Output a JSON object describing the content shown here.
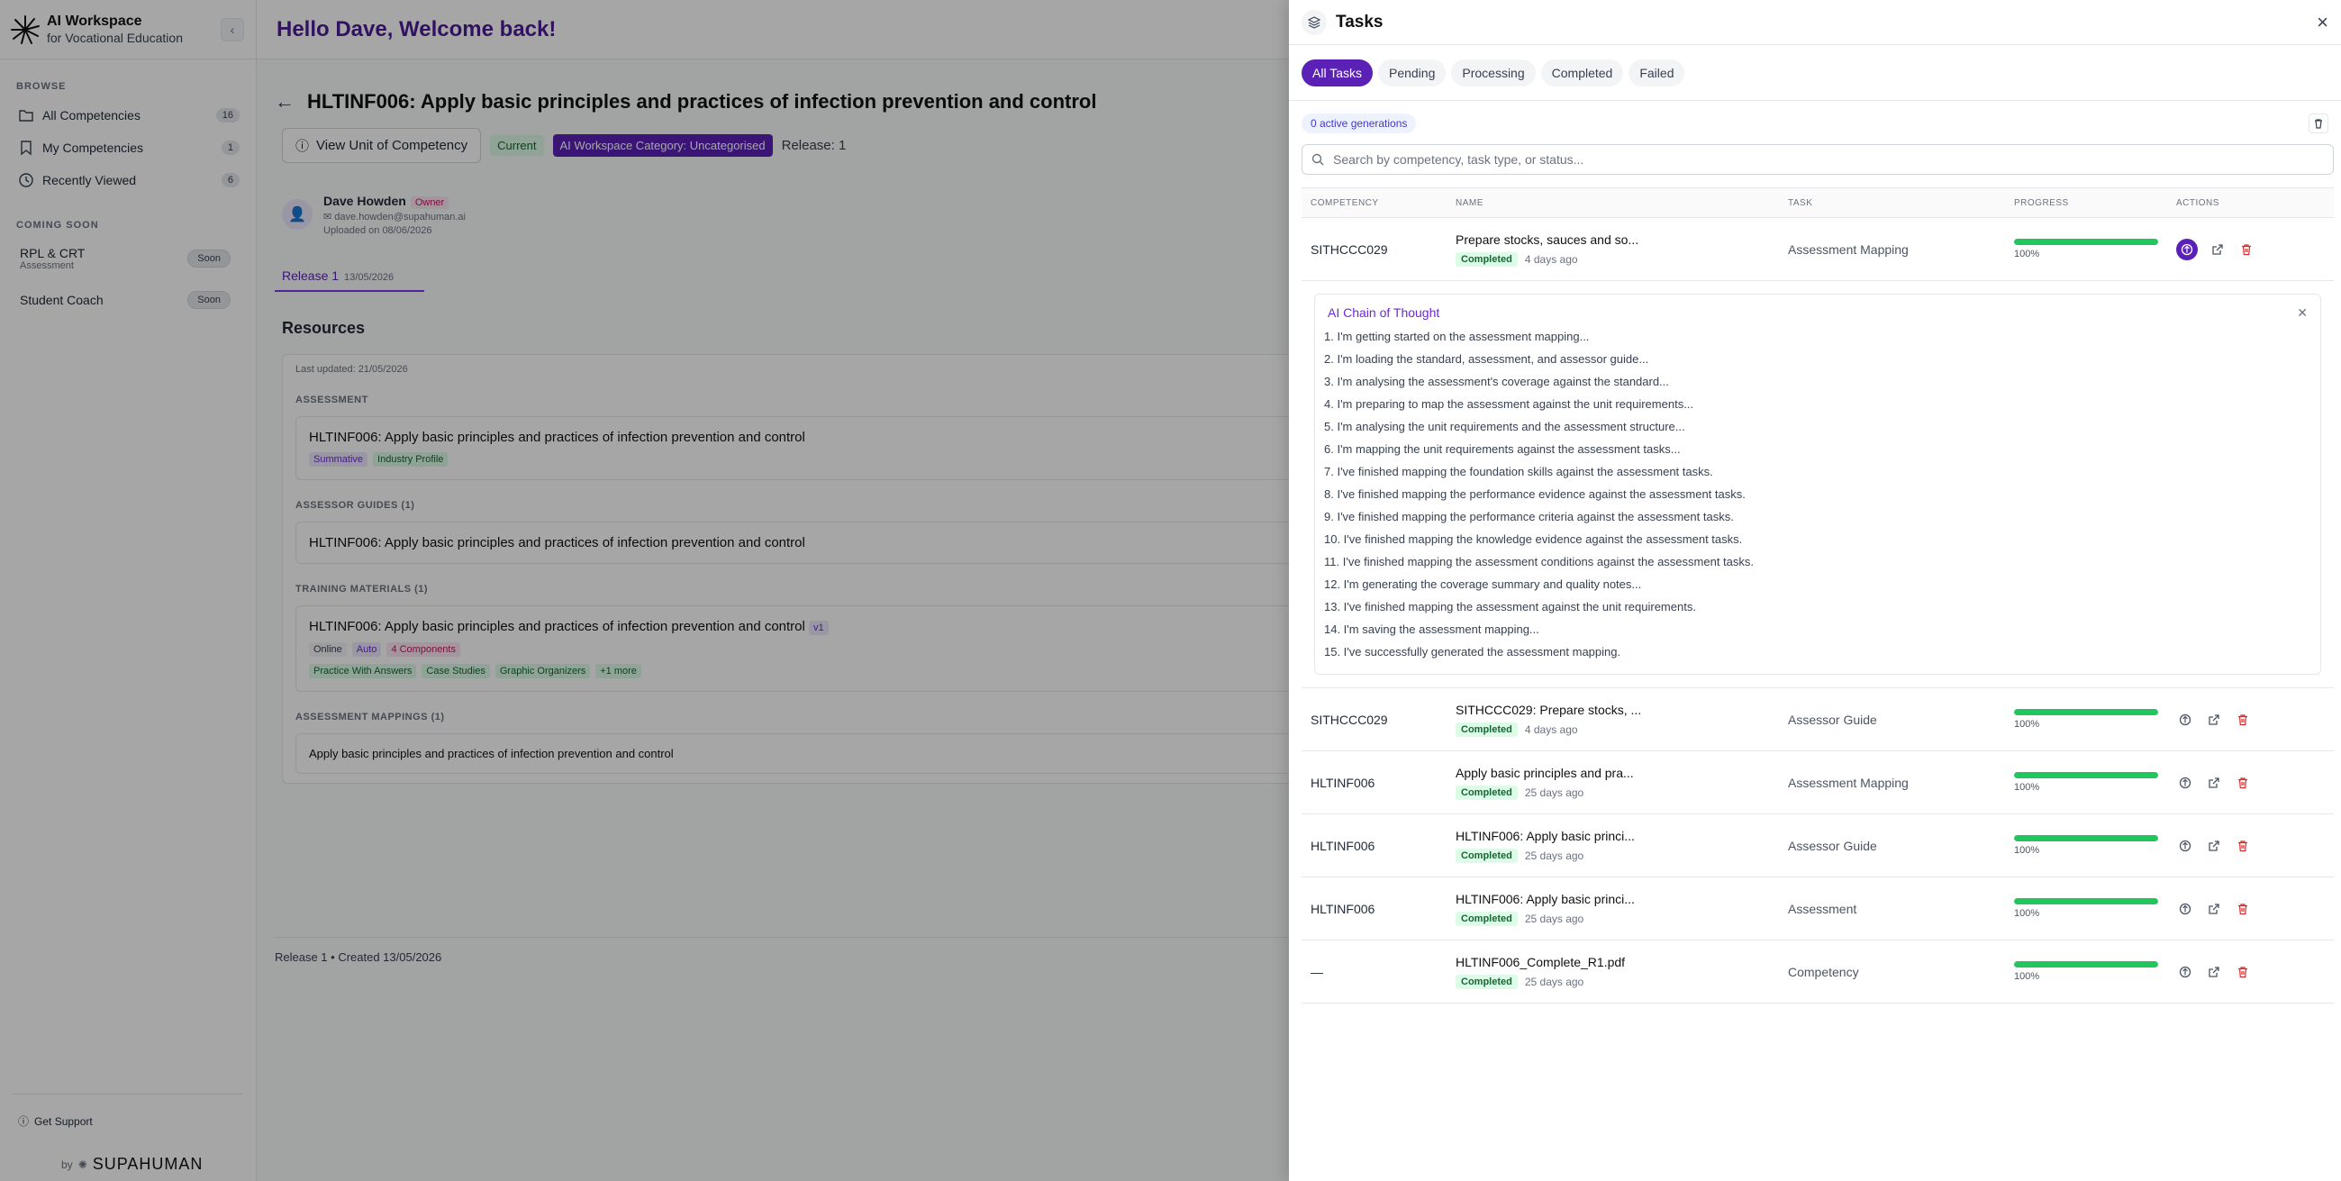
{
  "sidebar": {
    "brand_title": "AI Workspace",
    "brand_sub": "for Vocational Education",
    "browse_label": "BROWSE",
    "items": [
      {
        "label": "All Competencies",
        "count": "16",
        "icon": "folder-icon"
      },
      {
        "label": "My Competencies",
        "count": "1",
        "icon": "bookmark-icon"
      },
      {
        "label": "Recently Viewed",
        "count": "6",
        "icon": "clock-icon"
      }
    ],
    "coming_soon_label": "COMING SOON",
    "soon_items": [
      {
        "label": "RPL & CRT",
        "sub": "Assessment",
        "badge": "Soon"
      },
      {
        "label": "Student Coach",
        "sub": "",
        "badge": "Soon"
      }
    ],
    "support": "Get Support",
    "powered_by": "by",
    "powered_brand": "SUPAHUMAN"
  },
  "main": {
    "greeting": "Hello Dave, Welcome back!",
    "title": "HLTINF006: Apply basic principles and practices of infection prevention and control",
    "view_unit": "View Unit of Competency",
    "current": "Current",
    "category": "AI Workspace Category: Uncategorised",
    "release": "Release: 1",
    "owner_name": "Dave Howden",
    "owner_badge": "Owner",
    "owner_email": "dave.howden@supahuman.ai",
    "uploaded": "Uploaded on 08/06/2026",
    "release_tab": "Release 1",
    "release_tab_date": "13/05/2026",
    "resources_title": "Resources",
    "last_updated": "Last updated: 21/05/2026",
    "sections": {
      "assessment": "ASSESSMENT",
      "assessor_guides": "ASSESSOR GUIDES (1)",
      "training": "TRAINING MATERIALS (1)",
      "mappings": "ASSESSMENT MAPPINGS (1)"
    },
    "assessment_item": "HLTINF006: Apply basic principles and practices of infection prevention and control",
    "assessment_tags": [
      "Summative",
      "Industry Profile"
    ],
    "guide_item": "HLTINF006: Apply basic principles and practices of infection prevention and control",
    "training_item": "HLTINF006: Apply basic principles and practices of infection prevention and control",
    "training_version": "v1",
    "training_tags_a": [
      "Online",
      "Auto",
      "4 Components"
    ],
    "training_tags_b": [
      "Practice With Answers",
      "Case Studies",
      "Graphic Organizers",
      "+1 more"
    ],
    "mapping_item": "Apply basic principles and practices of infection prevention and control",
    "footer": "Release 1 • Created 13/05/2026"
  },
  "tasks": {
    "title": "Tasks",
    "tabs": [
      "All Tasks",
      "Pending",
      "Processing",
      "Completed",
      "Failed"
    ],
    "active_tab": "All Tasks",
    "active_generations": "0 active generations",
    "search_placeholder": "Search by competency, task type, or status...",
    "headers": [
      "COMPETENCY",
      "NAME",
      "TASK",
      "PROGRESS",
      "ACTIONS"
    ],
    "rows": [
      {
        "competency": "SITHCCC029",
        "name": "Prepare stocks, sauces and so...",
        "status": "Completed",
        "time": "4 days ago",
        "task": "Assessment Mapping",
        "progress": 1.0,
        "progress_label": "100%"
      },
      {
        "competency": "SITHCCC029",
        "name": "SITHCCC029: Prepare stocks, ...",
        "status": "Completed",
        "time": "4 days ago",
        "task": "Assessor Guide",
        "progress": 1.0,
        "progress_label": "100%"
      },
      {
        "competency": "HLTINF006",
        "name": "Apply basic principles and pra...",
        "status": "Completed",
        "time": "25 days ago",
        "task": "Assessment Mapping",
        "progress": 1.0,
        "progress_label": "100%"
      },
      {
        "competency": "HLTINF006",
        "name": "HLTINF006: Apply basic princi...",
        "status": "Completed",
        "time": "25 days ago",
        "task": "Assessor Guide",
        "progress": 1.0,
        "progress_label": "100%"
      },
      {
        "competency": "HLTINF006",
        "name": "HLTINF006: Apply basic princi...",
        "status": "Completed",
        "time": "25 days ago",
        "task": "Assessment",
        "progress": 1.0,
        "progress_label": "100%"
      },
      {
        "competency": "—",
        "name": "HLTINF006_Complete_R1.pdf",
        "status": "Completed",
        "time": "25 days ago",
        "task": "Competency",
        "progress": 1.0,
        "progress_label": "100%"
      }
    ],
    "cot_title": "AI Chain of Thought",
    "cot_steps": [
      "1. I'm getting started on the assessment mapping...",
      "2. I'm loading the standard, assessment, and assessor guide...",
      "3. I'm analysing the assessment's coverage against the standard...",
      "4. I'm preparing to map the assessment against the unit requirements...",
      "5. I'm analysing the unit requirements and the assessment structure...",
      "6. I'm mapping the unit requirements against the assessment tasks...",
      "7. I've finished mapping the foundation skills against the assessment tasks.",
      "8. I've finished mapping the performance evidence against the assessment tasks.",
      "9. I've finished mapping the performance criteria against the assessment tasks.",
      "10. I've finished mapping the knowledge evidence against the assessment tasks.",
      "11. I've finished mapping the assessment conditions against the assessment tasks.",
      "12. I'm generating the coverage summary and quality notes...",
      "13. I've finished mapping the assessment against the unit requirements.",
      "14. I'm saving the assessment mapping...",
      "15. I've successfully generated the assessment mapping."
    ]
  },
  "colors": {
    "accent": "#5b21b6",
    "progress": "#22c55e",
    "danger": "#dc2626"
  }
}
